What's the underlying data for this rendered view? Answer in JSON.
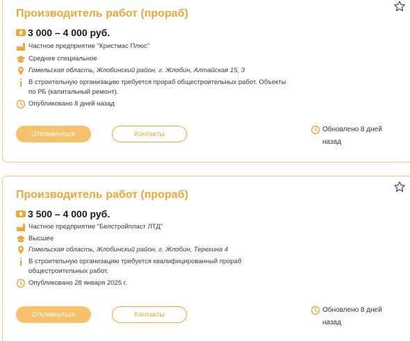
{
  "colors": {
    "accent": "#f0a73a",
    "accent_light": "#f7c16c",
    "card_border": "#f3c77f"
  },
  "listings": [
    {
      "title": "Производитель работ (прораб)",
      "salary": "3 000 – 4 000 руб.",
      "company": "Частное предприятие \"Кристмас Плюс\"",
      "education": "Среднее специальное",
      "address": "Гомельская область, Жлобинский район, г. Жлобин, Алтайская 15, 3",
      "description": "В строительную организацию требуется прораб общестроительных работ. Объекты по РБ (капитальный ремонт).",
      "published": "Опубликовано 8 дней назад",
      "respond_label": "Откликнуться",
      "contacts_label": "Контакты",
      "updated": "Обновлено 8 дней назад",
      "icons": [
        "star-outline-icon",
        "money-icon",
        "factory-icon",
        "graduation-cap-icon",
        "location-pin-icon",
        "info-icon",
        "clock-icon"
      ]
    },
    {
      "title": "Производитель работ (прораб)",
      "salary": "3 500 – 4 000 руб.",
      "company": "Частное предприятие \"Белстройпласт ЛТД\"",
      "education": "Высшее",
      "address": "Гомельская область, Жлобинский район, г. Жлобин, Терехина 4",
      "description": "В строительную организацию требуется квалифицированный прораб общестроительных работ.",
      "published": "Опубликовано 28 января 2025 г.",
      "respond_label": "Откликнуться",
      "contacts_label": "Контакты",
      "updated": "Обновлено 8 дней назад",
      "icons": [
        "star-outline-icon",
        "money-icon",
        "factory-icon",
        "graduation-cap-icon",
        "location-pin-icon",
        "info-icon",
        "clock-icon"
      ]
    }
  ]
}
